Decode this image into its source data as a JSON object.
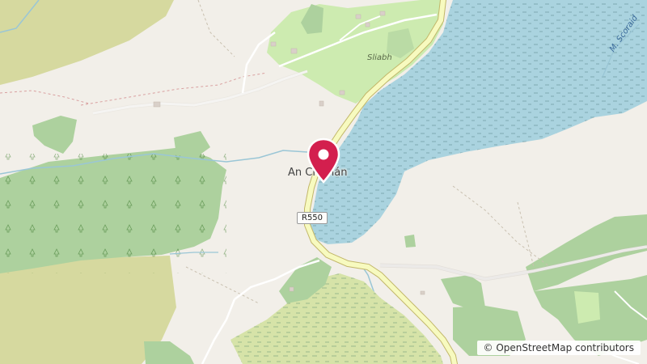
{
  "map": {
    "place_label": "An Clochán",
    "locality_label": "Sliabh",
    "water_label": "M. Scoraid",
    "road_label": "R550",
    "attribution": "© OpenStreetMap contributors",
    "marker_icon": "map-pin-icon",
    "colors": {
      "land": "#f2efe9",
      "forest": "#add19e",
      "water": "#aad3df",
      "wetland": "#d6e3a8",
      "road": "#f7fabf",
      "marker": "#d31f4e"
    }
  }
}
